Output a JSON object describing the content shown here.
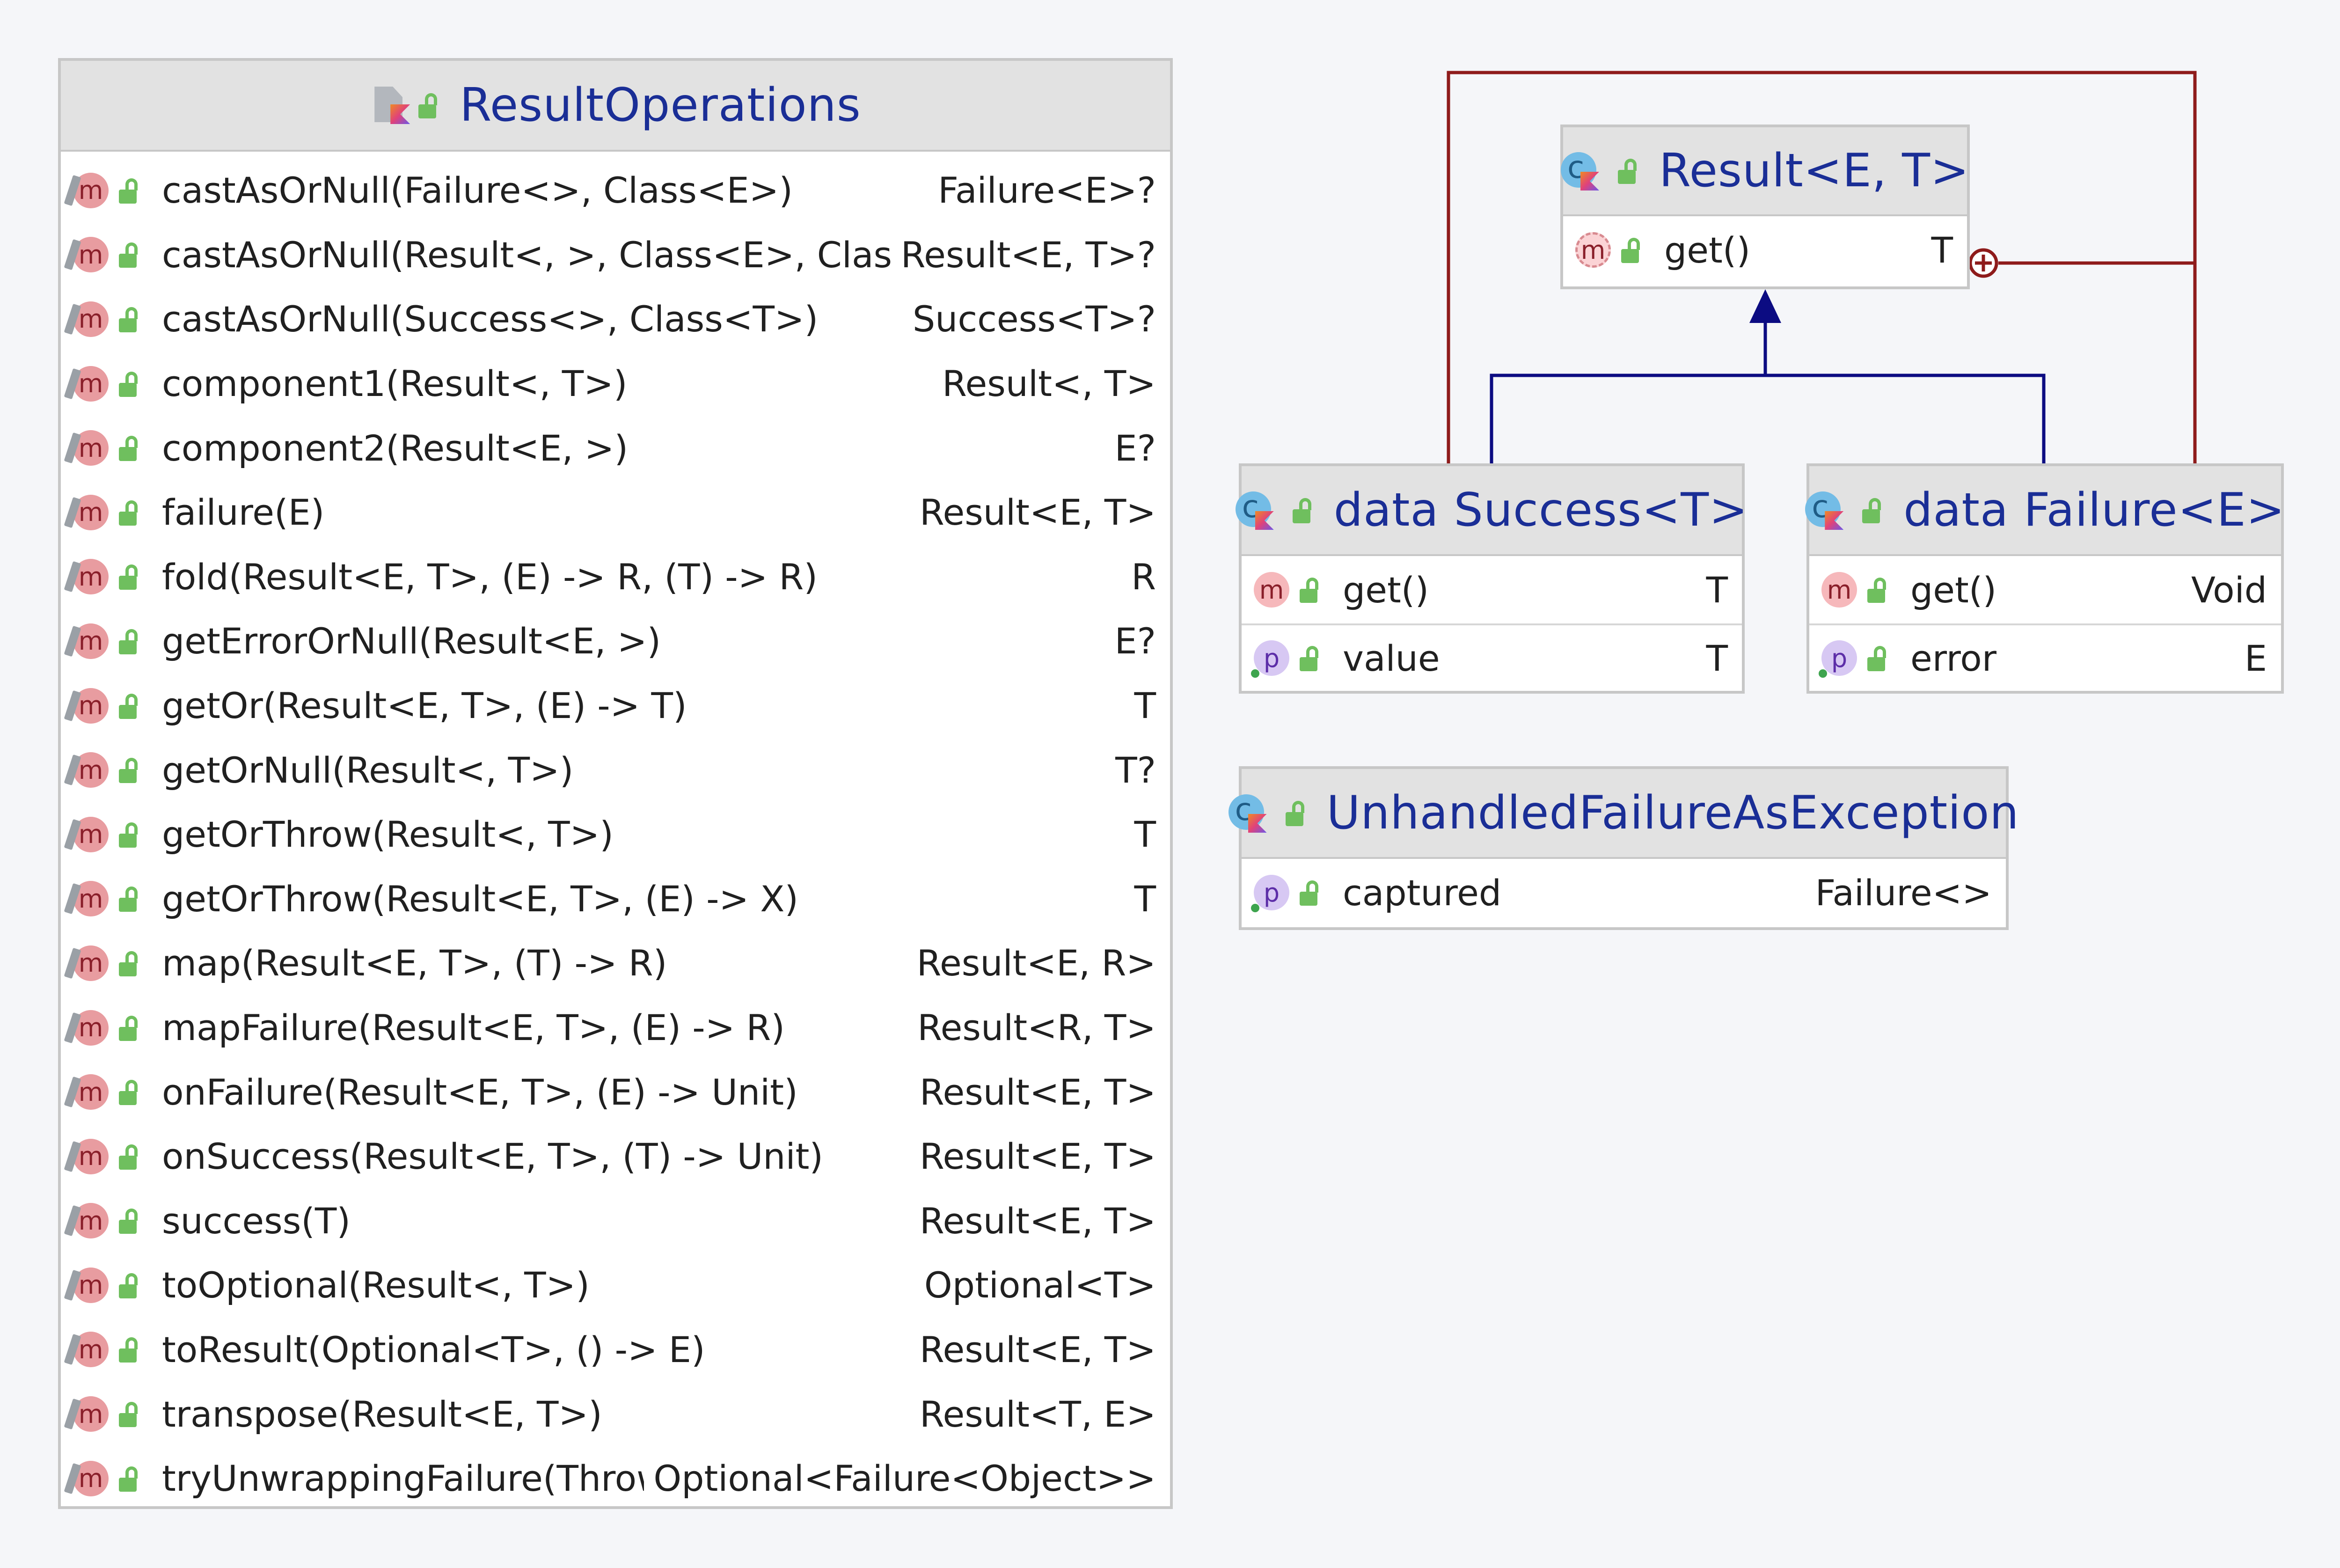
{
  "colors": {
    "background": "#f5f6f9",
    "title": "#1a2e96",
    "inheritance_arrow": "#0c0c82",
    "nested_link": "#8e1b1b",
    "method_badge": "#f6b8bb",
    "property_badge": "#d7c8f3",
    "lock": "#6fbf5e"
  },
  "classes": {
    "result_operations": {
      "title": "ResultOperations",
      "icon": "kotlin-file-icon",
      "members": [
        {
          "sig": "castAsOrNull(Failure<>, Class<E>)",
          "type": "Failure<E>?"
        },
        {
          "sig": "castAsOrNull(Result<, >, Class<E>, Class<T>)",
          "type": "Result<E, T>?"
        },
        {
          "sig": "castAsOrNull(Success<>, Class<T>)",
          "type": "Success<T>?"
        },
        {
          "sig": "component1(Result<, T>)",
          "type": "Result<, T>"
        },
        {
          "sig": "component2(Result<E, >)",
          "type": "E?"
        },
        {
          "sig": "failure(E)",
          "type": "Result<E, T>"
        },
        {
          "sig": "fold(Result<E, T>, (E) -> R, (T) -> R)",
          "type": "R"
        },
        {
          "sig": "getErrorOrNull(Result<E, >)",
          "type": "E?"
        },
        {
          "sig": "getOr(Result<E, T>, (E) -> T)",
          "type": "T"
        },
        {
          "sig": "getOrNull(Result<, T>)",
          "type": "T?"
        },
        {
          "sig": "getOrThrow(Result<, T>)",
          "type": "T"
        },
        {
          "sig": "getOrThrow(Result<E, T>, (E) -> X)",
          "type": "T"
        },
        {
          "sig": "map(Result<E, T>, (T) -> R)",
          "type": "Result<E, R>"
        },
        {
          "sig": "mapFailure(Result<E, T>, (E) -> R)",
          "type": "Result<R, T>"
        },
        {
          "sig": "onFailure(Result<E, T>, (E) -> Unit)",
          "type": "Result<E, T>"
        },
        {
          "sig": "onSuccess(Result<E, T>, (T) -> Unit)",
          "type": "Result<E, T>"
        },
        {
          "sig": "success(T)",
          "type": "Result<E, T>"
        },
        {
          "sig": "toOptional(Result<, T>)",
          "type": "Optional<T>"
        },
        {
          "sig": "toResult(Optional<T>, () -> E)",
          "type": "Result<E, T>"
        },
        {
          "sig": "transpose(Result<E, T>)",
          "type": "Result<T, E>"
        },
        {
          "sig": "tryUnwrappingFailure(Throwable)",
          "type": "Optional<Failure<Object>>"
        }
      ]
    },
    "result": {
      "title": "Result<E, T>",
      "icon": "abstract-class-icon",
      "members": [
        {
          "kind": "m",
          "sig": "get()",
          "type": "T"
        }
      ]
    },
    "success": {
      "title": "data Success<T>",
      "icon": "class-icon",
      "members": [
        {
          "kind": "m",
          "sig": "get()",
          "type": "T"
        },
        {
          "kind": "p",
          "sig": "value",
          "type": "T"
        }
      ]
    },
    "failure": {
      "title": "data Failure<E>",
      "icon": "class-icon",
      "members": [
        {
          "kind": "m",
          "sig": "get()",
          "type": "Void"
        },
        {
          "kind": "p",
          "sig": "error",
          "type": "E"
        }
      ]
    },
    "unhandled": {
      "title": "UnhandledFailureAsException",
      "icon": "class-icon",
      "members": [
        {
          "kind": "p",
          "sig": "captured",
          "type": "Failure<>"
        }
      ]
    }
  },
  "relations": [
    {
      "kind": "inheritance",
      "from": "data Success<T>",
      "to": "Result<E, T>"
    },
    {
      "kind": "inheritance",
      "from": "data Failure<E>",
      "to": "Result<E, T>"
    },
    {
      "kind": "nested",
      "from": "data Success<T>",
      "to": "Result<E, T>"
    },
    {
      "kind": "nested",
      "from": "data Failure<E>",
      "to": "Result<E, T>"
    }
  ]
}
